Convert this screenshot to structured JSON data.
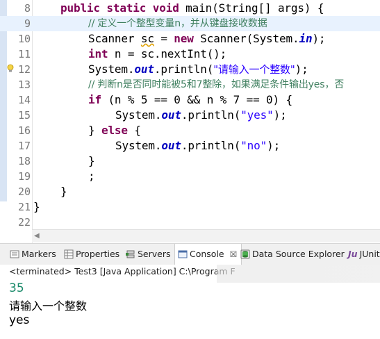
{
  "editor": {
    "lines": [
      {
        "n": "8"
      },
      {
        "n": "9"
      },
      {
        "n": "10"
      },
      {
        "n": "11"
      },
      {
        "n": "12"
      },
      {
        "n": "13"
      },
      {
        "n": "14"
      },
      {
        "n": "15"
      },
      {
        "n": "16"
      },
      {
        "n": "17"
      },
      {
        "n": "18"
      },
      {
        "n": "19"
      },
      {
        "n": "20"
      },
      {
        "n": "21"
      },
      {
        "n": "22"
      }
    ],
    "code": {
      "l8_kw": "public static void",
      "l8_rest": " main(String[] args) {",
      "l9": "// 定义一个整型变量n，并从键盘接收数据",
      "l10_a": "Scanner ",
      "l10_sc": "sc",
      "l10_b": " = ",
      "l10_new": "new",
      "l10_c": " Scanner(System.",
      "l10_in": "in",
      "l10_d": ");",
      "l11_kw": "int",
      "l11_rest": " n = sc.nextInt();",
      "l12_a": "System.",
      "l12_out": "out",
      "l12_b": ".println(",
      "l12_str": "\"请输入一个整数\"",
      "l12_c": ");",
      "l13": "// 判断n是否同时能被5和7整除，如果满足条件输出yes，否",
      "l14_kw": "if",
      "l14_rest": " (n % 5 == 0 && n % 7 == 0) {",
      "l15_a": "System.",
      "l15_out": "out",
      "l15_b": ".println(",
      "l15_str": "\"yes\"",
      "l15_c": ");",
      "l16_a": "} ",
      "l16_kw": "else",
      "l16_b": " {",
      "l17_a": "System.",
      "l17_out": "out",
      "l17_b": ".println(",
      "l17_str": "\"no\"",
      "l17_c": ");",
      "l18": "}",
      "l19": ";",
      "l20": "}",
      "l21": "}"
    }
  },
  "tabs": {
    "markers": "Markers",
    "properties": "Properties",
    "servers": "Servers",
    "console": "Console",
    "console_close": "☒",
    "dse": "Data Source Explorer",
    "junit": "JUnit"
  },
  "console": {
    "status": "<terminated> Test3 [Java Application] C:\\Program F",
    "input": "35",
    "output1": "请输入一个整数",
    "output2": "yes"
  },
  "colors": {
    "keyword": "#7f0055",
    "string": "#2a00ff",
    "comment": "#3f7f5f",
    "field": "#0000c0",
    "console_input": "#1a8a6a"
  }
}
